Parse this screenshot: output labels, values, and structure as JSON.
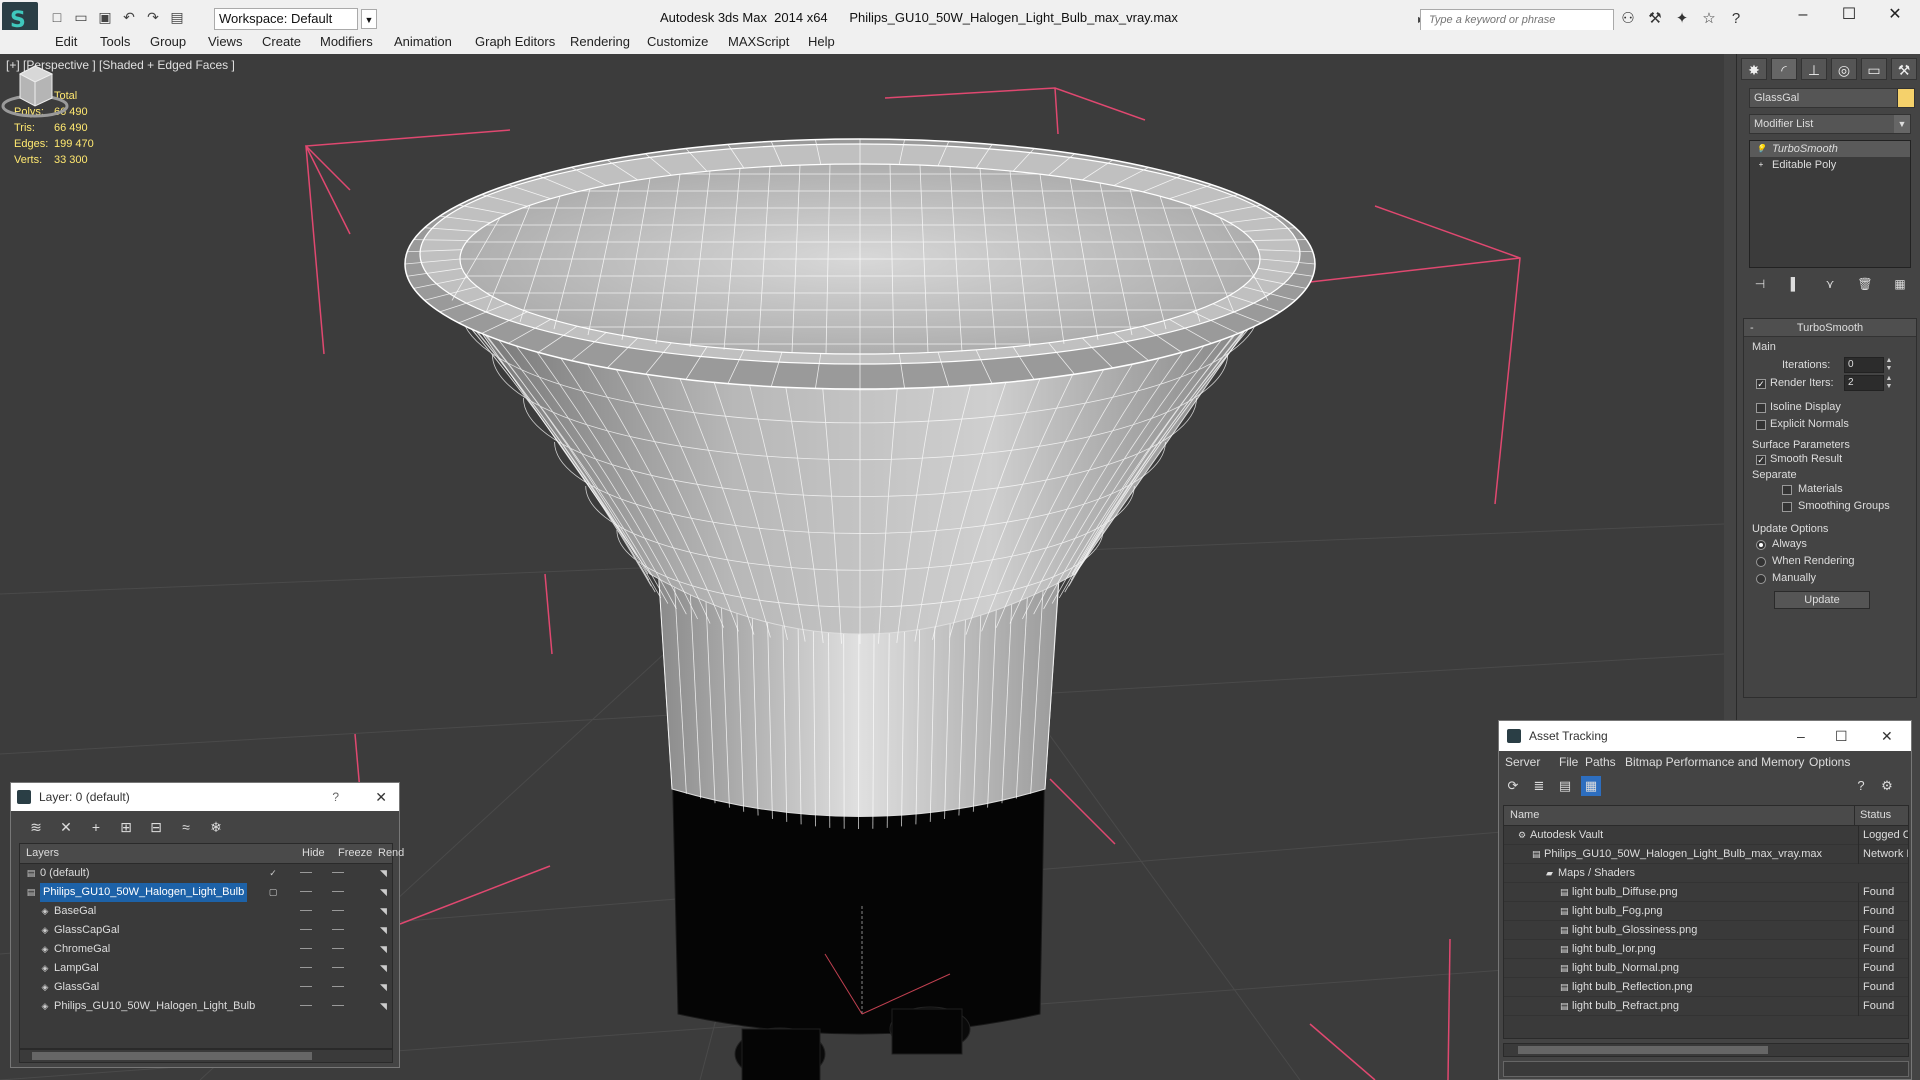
{
  "titlebar": {
    "workspace": "Workspace: Default",
    "title": "Autodesk 3ds Max  2014 x64      Philips_GU10_50W_Halogen_Light_Bulb_max_vray.max",
    "search_placeholder": "Type a keyword or phrase"
  },
  "menu": [
    "Edit",
    "Tools",
    "Group",
    "Views",
    "Create",
    "Modifiers",
    "Animation",
    "Graph Editors",
    "Rendering",
    "Customize",
    "MAXScript",
    "Help"
  ],
  "viewport": {
    "label": "[+] [Perspective ] [Shaded + Edged Faces ]",
    "stats": {
      "total_label": "Total",
      "rows": [
        {
          "k": "Polys:",
          "v": "66 490"
        },
        {
          "k": "Tris:",
          "v": "66 490"
        },
        {
          "k": "Edges:",
          "v": "199 470"
        },
        {
          "k": "Verts:",
          "v": "33 300"
        }
      ]
    },
    "accent_selection": "#e04870",
    "stats_color": "#ffe870"
  },
  "command_panel": {
    "object_name": "GlassGal",
    "object_color": "#f5d16b",
    "modifier_list": "Modifier List",
    "stack": [
      {
        "label": "TurboSmooth",
        "selected": true
      },
      {
        "label": "Editable Poly",
        "selected": false
      }
    ],
    "turbosmooth": {
      "title": "TurboSmooth",
      "main": "Main",
      "iterations_label": "Iterations:",
      "iterations": "0",
      "render_iters_label": "Render Iters:",
      "render_iters": "2",
      "isoline": "Isoline Display",
      "explicit_normals": "Explicit Normals",
      "surface_params": "Surface Parameters",
      "smooth_result": "Smooth Result",
      "separate": "Separate",
      "materials": "Materials",
      "smoothing_groups": "Smoothing Groups",
      "update_options": "Update Options",
      "always": "Always",
      "when_rendering": "When Rendering",
      "manually": "Manually",
      "update_button": "Update"
    }
  },
  "layer_dialog": {
    "title": "Layer: 0 (default)",
    "help": "?",
    "columns": [
      "Layers",
      "Hide",
      "Freeze",
      "Rend"
    ],
    "rows": [
      {
        "name": "0 (default)",
        "indent": 0,
        "selected": false
      },
      {
        "name": "Philips_GU10_50W_Halogen_Light_Bulb",
        "indent": 0,
        "selected": true
      },
      {
        "name": "BaseGal",
        "indent": 1,
        "selected": false
      },
      {
        "name": "GlassCapGal",
        "indent": 1,
        "selected": false
      },
      {
        "name": "ChromeGal",
        "indent": 1,
        "selected": false
      },
      {
        "name": "LampGal",
        "indent": 1,
        "selected": false
      },
      {
        "name": "GlassGal",
        "indent": 1,
        "selected": false
      },
      {
        "name": "Philips_GU10_50W_Halogen_Light_Bulb",
        "indent": 1,
        "selected": false
      }
    ]
  },
  "asset_tracking": {
    "title": "Asset Tracking",
    "menu": [
      "Server",
      "File",
      "Paths",
      "Bitmap Performance and Memory",
      "Options"
    ],
    "columns": [
      "Name",
      "Status"
    ],
    "rows": [
      {
        "name": "Autodesk Vault",
        "status": "Logged C",
        "indent": 1
      },
      {
        "name": "Philips_GU10_50W_Halogen_Light_Bulb_max_vray.max",
        "status": "Network I",
        "indent": 2
      },
      {
        "name": "Maps / Shaders",
        "status": "",
        "indent": 3
      },
      {
        "name": "light bulb_Diffuse.png",
        "status": "Found",
        "indent": 4
      },
      {
        "name": "light bulb_Fog.png",
        "status": "Found",
        "indent": 4
      },
      {
        "name": "light bulb_Glossiness.png",
        "status": "Found",
        "indent": 4
      },
      {
        "name": "light bulb_Ior.png",
        "status": "Found",
        "indent": 4
      },
      {
        "name": "light bulb_Normal.png",
        "status": "Found",
        "indent": 4
      },
      {
        "name": "light bulb_Reflection.png",
        "status": "Found",
        "indent": 4
      },
      {
        "name": "light bulb_Refract.png",
        "status": "Found",
        "indent": 4
      }
    ]
  }
}
